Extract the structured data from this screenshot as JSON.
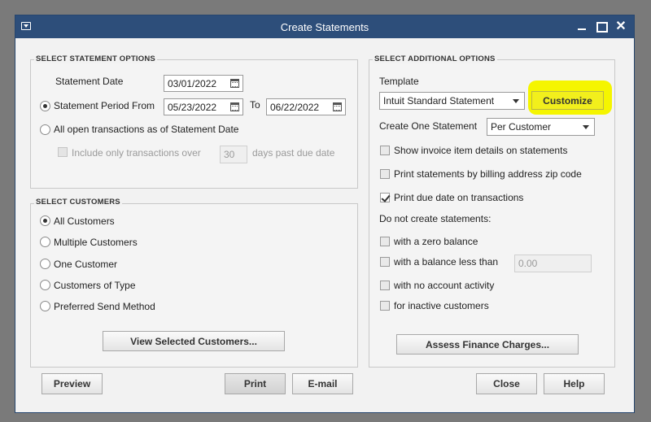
{
  "window": {
    "title": "Create Statements"
  },
  "statement_options": {
    "section_title": "SELECT STATEMENT OPTIONS",
    "statement_date_label": "Statement Date",
    "statement_date_value": "03/01/2022",
    "period_from_label": "Statement Period From",
    "period_from_value": "05/23/2022",
    "to_label": "To",
    "period_to_value": "06/22/2022",
    "all_open_label": "All open transactions as of Statement Date",
    "include_over_label": "Include only transactions over",
    "days_value": "30",
    "days_label": "days past due date",
    "selected_option": "period"
  },
  "customers": {
    "section_title": "SELECT CUSTOMERS",
    "options": [
      {
        "label": "All Customers",
        "selected": true
      },
      {
        "label": "Multiple Customers",
        "selected": false
      },
      {
        "label": "One Customer",
        "selected": false
      },
      {
        "label": "Customers of Type",
        "selected": false
      },
      {
        "label": "Preferred Send Method",
        "selected": false
      }
    ],
    "view_button": "View Selected Customers..."
  },
  "additional_options": {
    "section_title": "SELECT ADDITIONAL OPTIONS",
    "template_label": "Template",
    "template_value": "Intuit Standard Statement",
    "customize_button": "Customize",
    "create_one_label": "Create One Statement",
    "create_one_value": "Per Customer",
    "checks": [
      {
        "label": "Show invoice item details on statements",
        "checked": false
      },
      {
        "label": "Print statements by billing address zip code",
        "checked": false
      },
      {
        "label": "Print due date on transactions",
        "checked": true
      }
    ],
    "do_not_label": "Do not create statements:",
    "do_not_checks": [
      {
        "label": "with a zero balance",
        "checked": false
      },
      {
        "label": "with a balance less than",
        "checked": false
      },
      {
        "label": "with no account activity",
        "checked": false
      },
      {
        "label": "for inactive customers",
        "checked": false
      }
    ],
    "balance_less_than_value": "0.00",
    "finance_button": "Assess Finance Charges..."
  },
  "footer": {
    "preview": "Preview",
    "print": "Print",
    "email": "E-mail",
    "close": "Close",
    "help": "Help"
  },
  "colors": {
    "titlebar": "#2d4e7a",
    "highlight": "#f5f500"
  }
}
